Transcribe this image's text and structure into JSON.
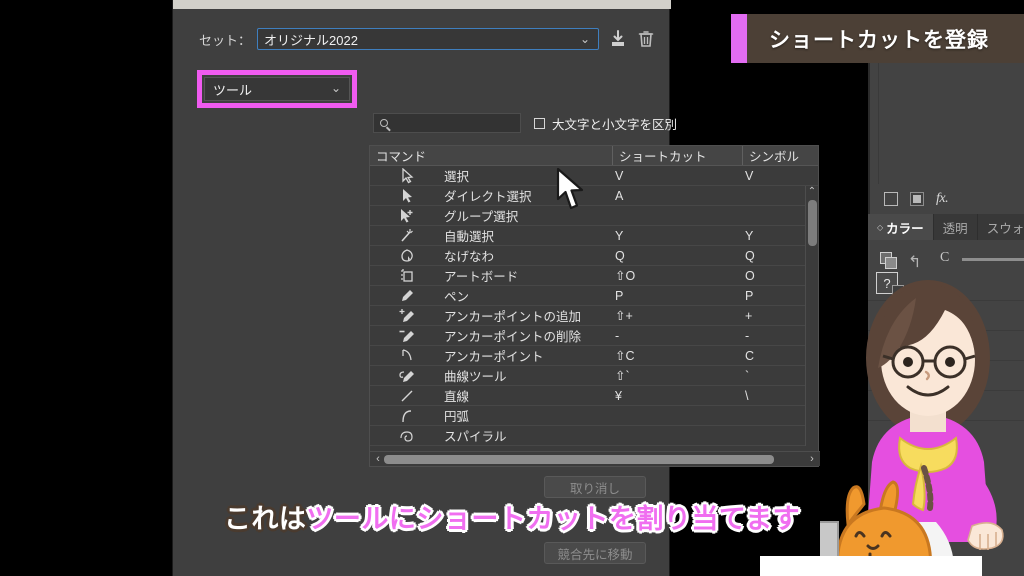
{
  "banner": {
    "text": "ショートカットを登録",
    "accent_color": "#e26cf2",
    "bg_color": "#4c4036"
  },
  "subtitle": {
    "white_part": "これは",
    "pink_part": "ツールにショートカットを割り当てます",
    "pink_color": "#f06ef0"
  },
  "dialog": {
    "set_row": {
      "label": "セット：",
      "value": "オリジナル2022",
      "chevron": "chevron-down-icon",
      "save_icon": "save-download-icon",
      "delete_icon": "trash-icon"
    },
    "category": {
      "value": "ツール",
      "chevron": "chevron-down-icon",
      "highlight_color": "#f05bf0"
    },
    "search": {
      "value": "",
      "placeholder": "",
      "icon": "search-icon"
    },
    "case_checkbox": {
      "label": "大文字と小文字を区別",
      "checked": false
    },
    "table": {
      "columns": [
        "コマンド",
        "ショートカット",
        "シンボル"
      ],
      "rows": [
        {
          "icon": "selection-tool-icon",
          "name": "選択",
          "shortcut": "V",
          "symbol": "V"
        },
        {
          "icon": "direct-selection-tool-icon",
          "name": "ダイレクト選択",
          "shortcut": "A",
          "symbol": ""
        },
        {
          "icon": "group-selection-tool-icon",
          "name": "グループ選択",
          "shortcut": "",
          "symbol": ""
        },
        {
          "icon": "magic-wand-tool-icon",
          "name": "自動選択",
          "shortcut": "Y",
          "symbol": "Y"
        },
        {
          "icon": "lasso-tool-icon",
          "name": "なげなわ",
          "shortcut": "Q",
          "symbol": "Q"
        },
        {
          "icon": "artboard-tool-icon",
          "name": "アートボード",
          "shortcut": "⇧O",
          "symbol": "O"
        },
        {
          "icon": "pen-tool-icon",
          "name": "ペン",
          "shortcut": "P",
          "symbol": "P"
        },
        {
          "icon": "add-anchor-point-icon",
          "name": "アンカーポイントの追加",
          "shortcut": "⇧+",
          "symbol": "+"
        },
        {
          "icon": "delete-anchor-point-icon",
          "name": "アンカーポイントの削除",
          "shortcut": "-",
          "symbol": "-"
        },
        {
          "icon": "anchor-point-tool-icon",
          "name": "アンカーポイント",
          "shortcut": "⇧C",
          "symbol": "C"
        },
        {
          "icon": "curvature-tool-icon",
          "name": "曲線ツール",
          "shortcut": "⇧`",
          "symbol": "`"
        },
        {
          "icon": "line-segment-tool-icon",
          "name": "直線",
          "shortcut": "¥",
          "symbol": "\\"
        },
        {
          "icon": "arc-tool-icon",
          "name": "円弧",
          "shortcut": "",
          "symbol": ""
        },
        {
          "icon": "spiral-tool-icon",
          "name": "スパイラル",
          "shortcut": "",
          "symbol": ""
        }
      ]
    },
    "buttons": {
      "undo": "取り消し",
      "goto_conflict": "競合先に移動"
    }
  },
  "app_panel": {
    "fx_label": "fx.",
    "tabs": [
      {
        "label": "カラー",
        "active": true
      },
      {
        "label": "透明",
        "active": false
      },
      {
        "label": "スウォッ",
        "active": false
      }
    ],
    "color_channel": "C",
    "help_badge": "?"
  }
}
